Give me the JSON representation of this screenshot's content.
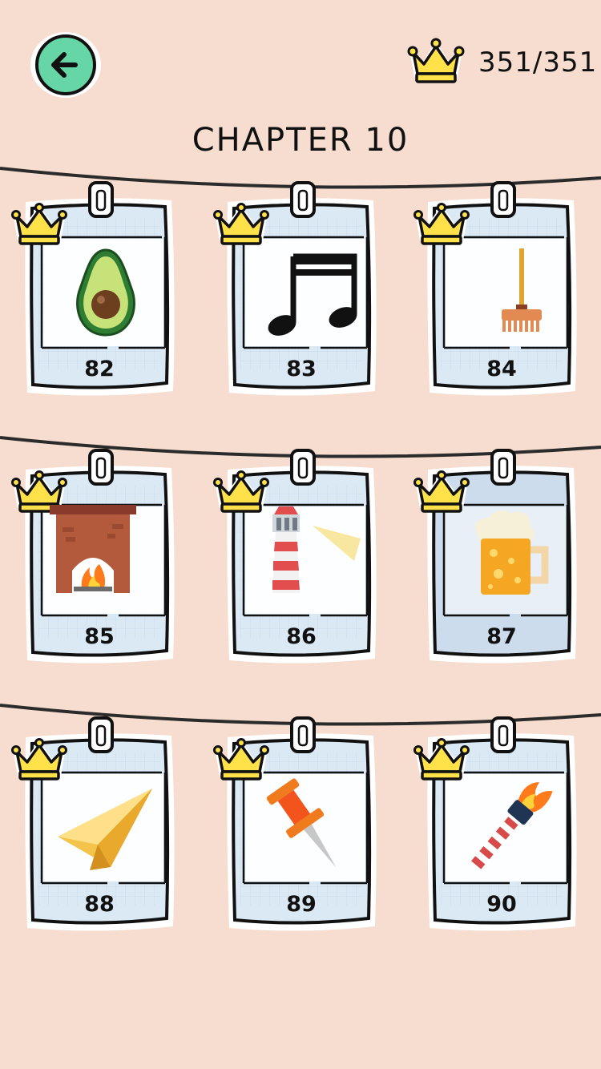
{
  "header": {
    "score": "351/351"
  },
  "chapter_title": "CHAPTER 10",
  "levels": [
    {
      "number": "82",
      "icon": "avocado-icon",
      "solved": true
    },
    {
      "number": "83",
      "icon": "music-note-icon",
      "solved": true
    },
    {
      "number": "84",
      "icon": "rake-icon",
      "solved": true
    },
    {
      "number": "85",
      "icon": "fireplace-icon",
      "solved": true
    },
    {
      "number": "86",
      "icon": "lighthouse-icon",
      "solved": true
    },
    {
      "number": "87",
      "icon": "beer-mug-icon",
      "solved": true
    },
    {
      "number": "88",
      "icon": "paper-plane-icon",
      "solved": true
    },
    {
      "number": "89",
      "icon": "pushpin-icon",
      "solved": true
    },
    {
      "number": "90",
      "icon": "torch-icon",
      "solved": true
    }
  ],
  "colors": {
    "background": "#f6ddd0",
    "accent_green": "#66d6a6",
    "crown_yellow": "#ffe14a",
    "card_blue": "#dbe9f5"
  }
}
